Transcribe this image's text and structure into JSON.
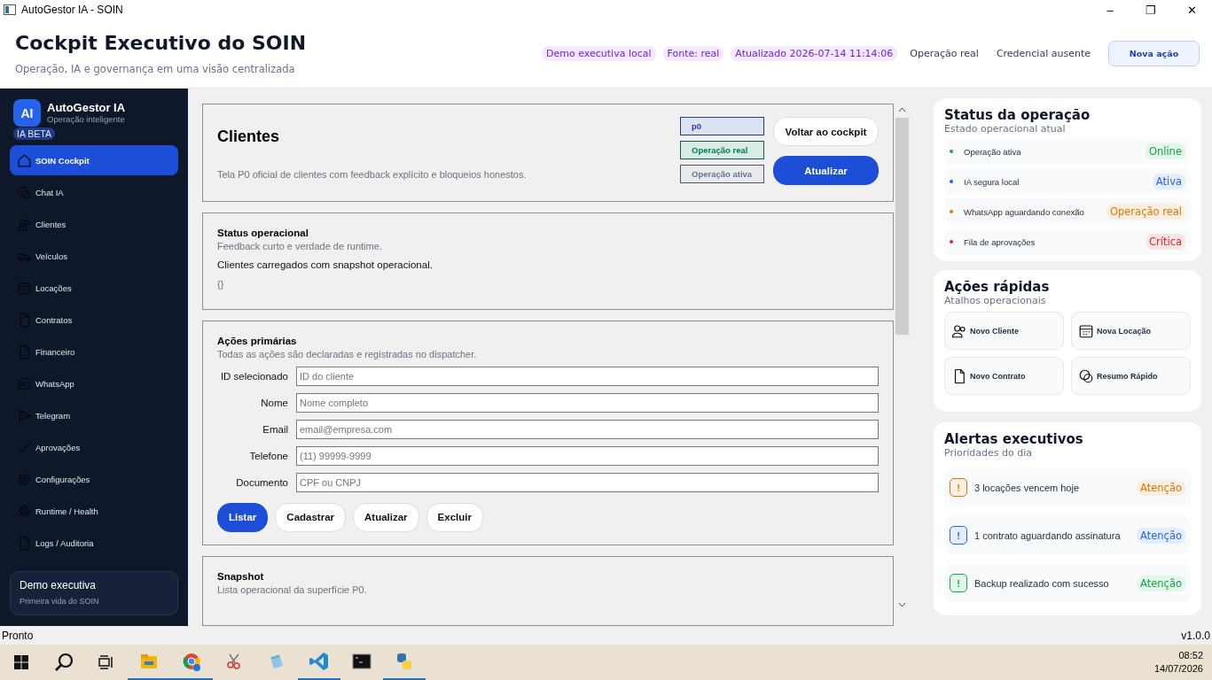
{
  "window": {
    "title": "AutoGestor IA - SOIN",
    "controls": [
      "–",
      "❐",
      "✕"
    ]
  },
  "header": {
    "title": "Cockpit Executivo do SOIN",
    "subtitle": "Operação, IA e governança em uma visão centralizada",
    "chips": [
      {
        "kind": "badge",
        "label": "Demo executiva local"
      },
      {
        "kind": "badge",
        "label": "Fonte: real"
      },
      {
        "kind": "badge",
        "label": "Atualizado 2026-07-14 11:14:06"
      },
      {
        "kind": "text",
        "label": "Operação real"
      },
      {
        "kind": "text",
        "label": "Credencial ausente"
      }
    ],
    "action_button": "Nova ação"
  },
  "sidebar": {
    "logo": "AI",
    "app_name": "AutoGestor IA",
    "tagline": "Operação inteligente",
    "badge": "IA BETA",
    "items": [
      {
        "label": "SOIN Cockpit",
        "selected": true
      },
      {
        "label": "Chat IA",
        "selected": false
      },
      {
        "label": "Clientes",
        "selected": false
      },
      {
        "label": "Veículos",
        "selected": false
      },
      {
        "label": "Locações",
        "selected": false
      },
      {
        "label": "Contratos",
        "selected": false
      },
      {
        "label": "Financeiro",
        "selected": false
      },
      {
        "label": "WhatsApp",
        "selected": false
      },
      {
        "label": "Telegram",
        "selected": false
      },
      {
        "label": "Aprovações",
        "selected": false
      },
      {
        "label": "Configurações",
        "selected": false
      },
      {
        "label": "Runtime / Health",
        "selected": false
      },
      {
        "label": "Logs / Auditoria",
        "selected": false
      }
    ],
    "footer": {
      "title": "Demo executiva",
      "subtitle": "Primeira vida do SOIN"
    }
  },
  "page": {
    "title": "Clientes",
    "description": "Tela P0 oficial de clientes com feedback explícito e bloqueios honestos.",
    "tags": [
      {
        "label": "p0",
        "color": "#1e40af"
      },
      {
        "label": "Operação real",
        "color": "#047857"
      },
      {
        "label": "Operação ativa",
        "color": "#64748b"
      }
    ],
    "buttons": [
      {
        "kind": "secondary",
        "label": "Voltar ao cockpit"
      },
      {
        "kind": "primary",
        "label": "Atualizar"
      }
    ],
    "status": {
      "title": "Status operacional",
      "subtitle": "Feedback curto e verdade de runtime.",
      "message": "Clientes carregados com snapshot operacional.",
      "payload": "{}"
    },
    "actions": {
      "title": "Ações primárias",
      "subtitle": "Todas as ações são declaradas e registradas no dispatcher.",
      "fields": [
        {
          "label": "ID selecionado",
          "placeholder": "ID do cliente"
        },
        {
          "label": "Nome",
          "placeholder": "Nome completo"
        },
        {
          "label": "Email",
          "placeholder": "email@empresa.com"
        },
        {
          "label": "Telefone",
          "placeholder": "(11) 99999-9999"
        },
        {
          "label": "Documento",
          "placeholder": "CPF ou CNPJ"
        }
      ],
      "buttons": [
        {
          "kind": "primary",
          "label": "Listar"
        },
        {
          "kind": "secondary",
          "label": "Cadastrar"
        },
        {
          "kind": "secondary",
          "label": "Atualizar"
        },
        {
          "kind": "secondary",
          "label": "Excluir"
        }
      ]
    },
    "snapshot": {
      "title": "Snapshot",
      "subtitle": "Lista operacional da superfície P0."
    }
  },
  "status_panel": {
    "title": "Status da operação",
    "subtitle": "Estado operacional atual",
    "items": [
      {
        "label": "Operação ativa",
        "status": "Online",
        "color": "#16a34a"
      },
      {
        "label": "IA segura local",
        "status": "Ativa",
        "color": "#2563eb"
      },
      {
        "label": "WhatsApp aguardando conexão",
        "status": "Operação real",
        "color": "#d97706"
      },
      {
        "label": "Fila de aprovações",
        "status": "Crítica",
        "color": "#dc2626"
      }
    ]
  },
  "quick_actions": {
    "title": "Ações rápidas",
    "subtitle": "Atalhos operacionais",
    "items": [
      "Novo Cliente",
      "Nova Locação",
      "Novo Contrato",
      "Resumo Rápido"
    ]
  },
  "alerts": {
    "title": "Alertas executivos",
    "subtitle": "Prioridades do dia",
    "items": [
      {
        "mark": "!",
        "text": "3 locações vencem hoje",
        "tag": "Atenção",
        "color": "#d97706"
      },
      {
        "mark": "!",
        "text": "1 contrato aguardando assinatura",
        "tag": "Atenção",
        "color": "#2563eb"
      },
      {
        "mark": "!",
        "text": "Backup realizado com sucesso",
        "tag": "Atenção",
        "color": "#16a34a"
      }
    ]
  },
  "status_bar": {
    "left": "Pronto",
    "right": "v1.0.0"
  },
  "taskbar": {
    "apps": [
      {
        "running": true
      },
      {
        "running": true
      },
      {
        "running": false
      },
      {
        "running": false
      },
      {
        "running": true
      },
      {
        "running": false
      },
      {
        "running": true
      }
    ],
    "time": "08:52",
    "date": "14/07/2026"
  }
}
